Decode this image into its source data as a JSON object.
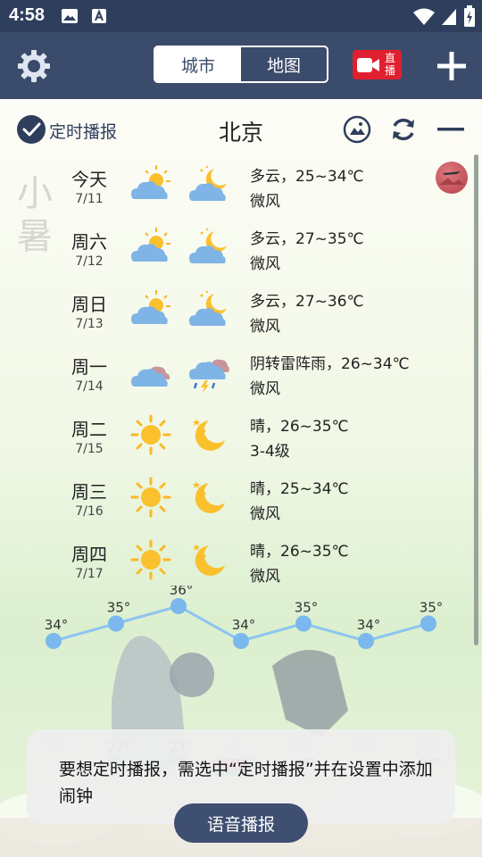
{
  "status_bar": {
    "time": "4:58"
  },
  "toolbar": {
    "tabs": [
      {
        "label": "城市",
        "active": true
      },
      {
        "label": "地图",
        "active": false
      }
    ],
    "live_label": "直播",
    "accent": "#3b4b6b",
    "live_color": "#e02030"
  },
  "header": {
    "scheduled_label": "定时播报",
    "city": "北京"
  },
  "solar_term": "小暑",
  "forecast": [
    {
      "day": "今天",
      "date": "7/11",
      "day_icon": "partly-cloudy-icon",
      "night_icon": "cloudy-night-icon",
      "desc": "多云，25~34℃",
      "wind": "微风"
    },
    {
      "day": "周六",
      "date": "7/12",
      "day_icon": "partly-cloudy-icon",
      "night_icon": "cloudy-night-icon",
      "desc": "多云，27~35℃",
      "wind": "微风"
    },
    {
      "day": "周日",
      "date": "7/13",
      "day_icon": "partly-cloudy-icon",
      "night_icon": "cloudy-night-icon",
      "desc": "多云，27~36℃",
      "wind": "微风"
    },
    {
      "day": "周一",
      "date": "7/14",
      "day_icon": "overcast-icon",
      "night_icon": "thunderstorm-icon",
      "desc": "阴转雷阵雨，26~34℃",
      "wind": "微风"
    },
    {
      "day": "周二",
      "date": "7/15",
      "day_icon": "sunny-icon",
      "night_icon": "clear-night-icon",
      "desc": "晴，26~35℃",
      "wind": "3-4级"
    },
    {
      "day": "周三",
      "date": "7/16",
      "day_icon": "sunny-icon",
      "night_icon": "clear-night-icon",
      "desc": "晴，25~34℃",
      "wind": "微风"
    },
    {
      "day": "周四",
      "date": "7/17",
      "day_icon": "sunny-icon",
      "night_icon": "clear-night-icon",
      "desc": "晴，26~35℃",
      "wind": "微风"
    }
  ],
  "chart_data": {
    "type": "line",
    "categories": [
      "今天",
      "周六",
      "周日",
      "周一",
      "周二",
      "周三",
      "周四"
    ],
    "series": [
      {
        "values": [
          34,
          35,
          36,
          34,
          35,
          34,
          35
        ]
      },
      {
        "values": [
          25,
          27,
          27,
          26,
          26,
          25,
          26
        ]
      }
    ],
    "unit": "°",
    "line_color": "#8ec4f0",
    "point_color": "#7ab8ee"
  },
  "toast": {
    "text": "要想定时播报，需选中“定时播报”并在设置中添加闹钟"
  },
  "voice_button": {
    "label": "语音播报"
  }
}
